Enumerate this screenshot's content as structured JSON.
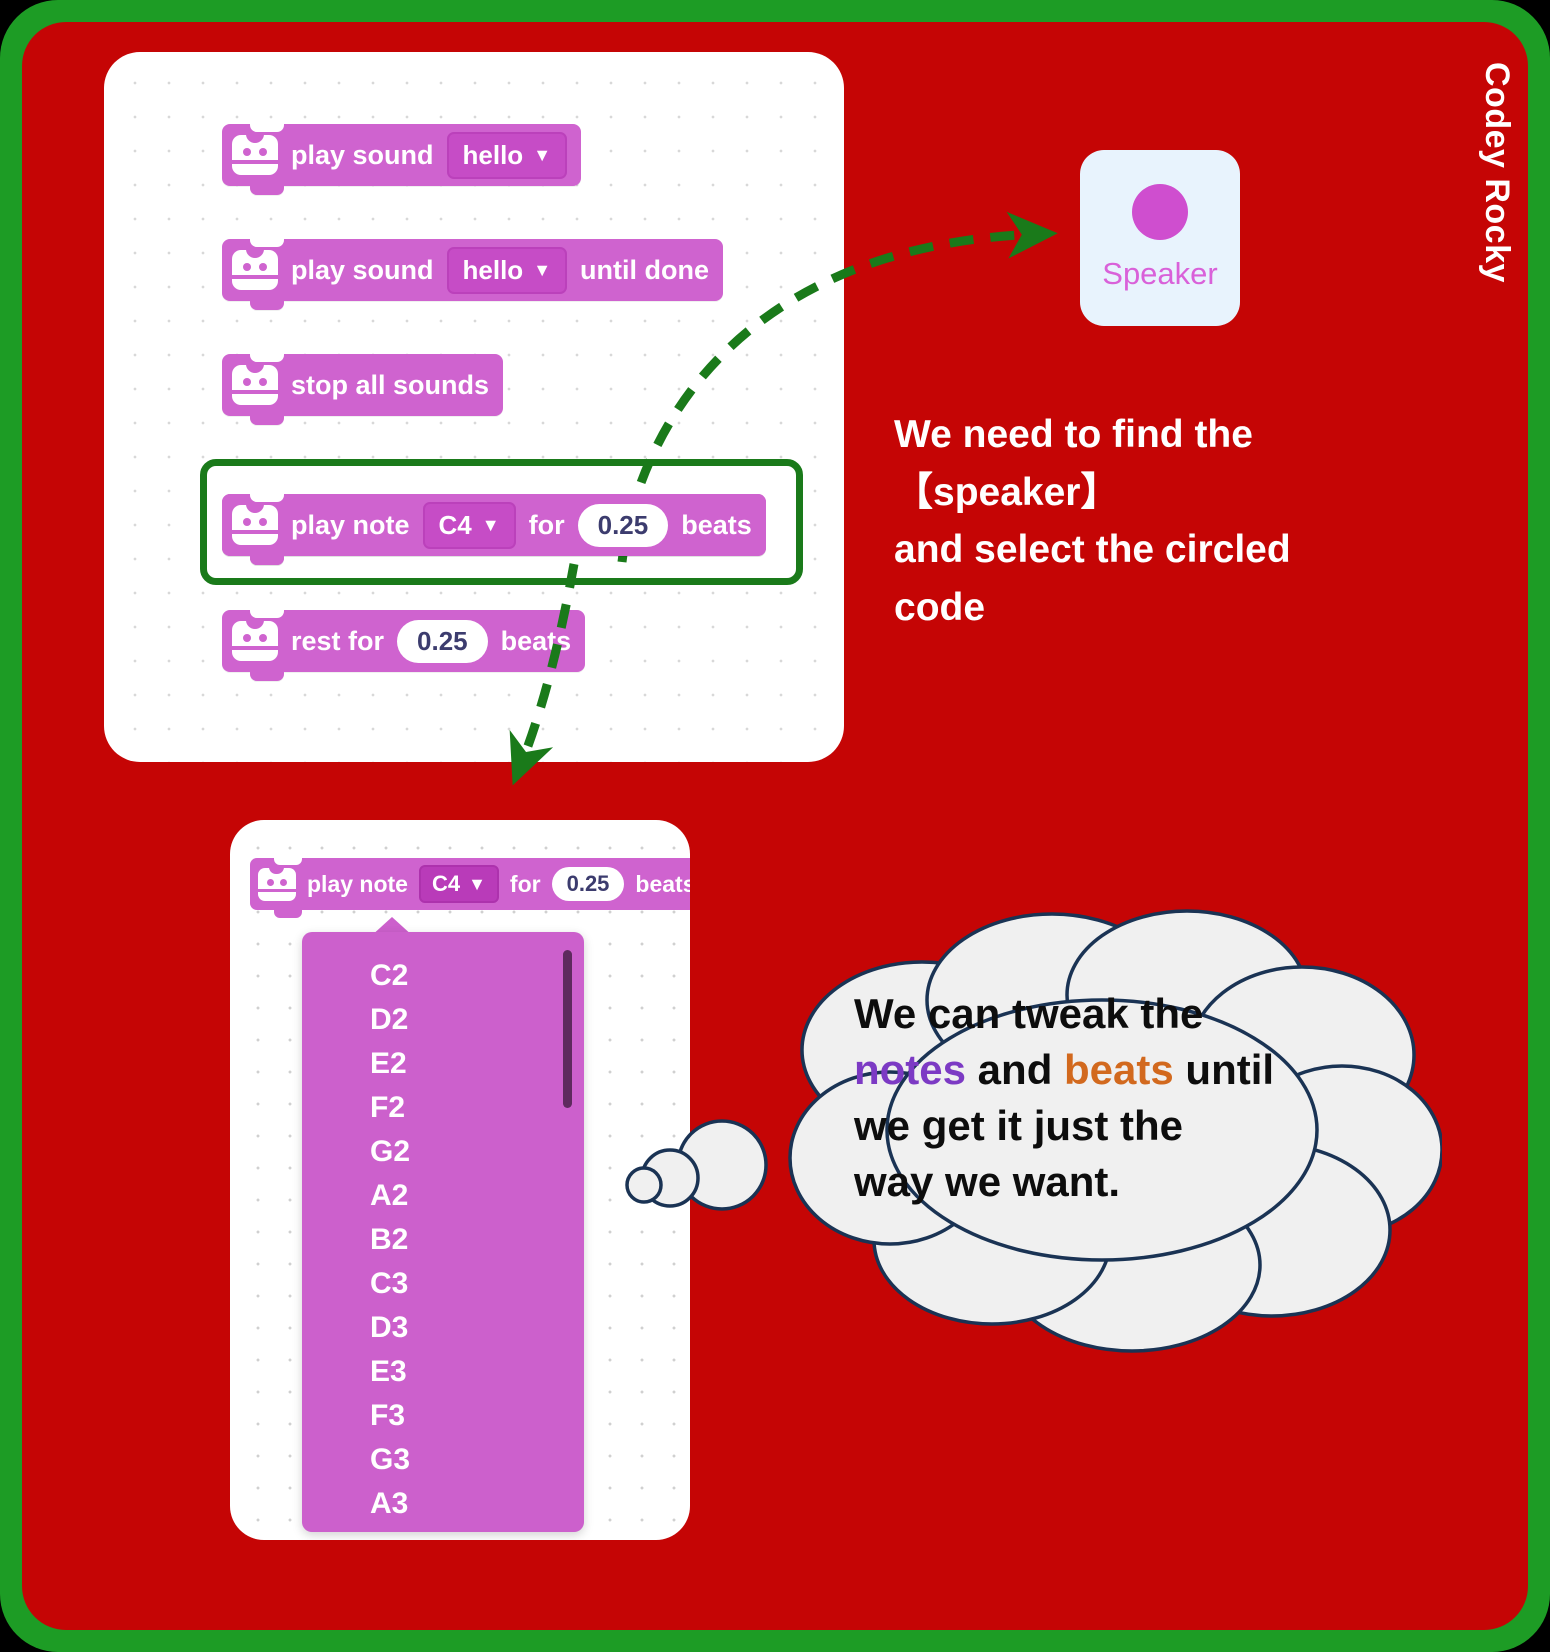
{
  "brand": {
    "label": "Codey Rocky"
  },
  "colors": {
    "frame_green": "#1d9c25",
    "canvas_red": "#c50505",
    "block_magenta": "#cf63cf",
    "arrow_green": "#1a7a1a",
    "speaker_card_bg": "#e8f3fd",
    "speaker_text": "#d961d9",
    "notes_purple": "#7c3ac4",
    "beats_orange": "#d2691e",
    "bubble_outline": "#1a3354",
    "bubble_fill": "#f0f0f0"
  },
  "code_panel": {
    "blocks": [
      {
        "id": "play-sound",
        "text_before": "play sound",
        "dropdown": "hello",
        "text_mid": "",
        "number": "",
        "text_after": ""
      },
      {
        "id": "play-sound-until",
        "text_before": "play sound",
        "dropdown": "hello",
        "text_mid": "",
        "number": "",
        "text_after": "until done"
      },
      {
        "id": "stop-all-sounds",
        "text_before": "stop all sounds",
        "dropdown": "",
        "text_mid": "",
        "number": "",
        "text_after": ""
      },
      {
        "id": "play-note",
        "text_before": "play note",
        "dropdown": "C4",
        "text_mid": "for",
        "number": "0.25",
        "text_after": "beats"
      },
      {
        "id": "rest-for",
        "text_before": "rest for",
        "dropdown": "",
        "text_mid": "",
        "number": "0.25",
        "text_after": "beats"
      }
    ],
    "selected_block_id": "play-note"
  },
  "speaker_card": {
    "label": "Speaker",
    "icon": "speaker-dot-icon"
  },
  "instruction": {
    "text": "We need to find the\n 【speaker】\nand select the circled\ncode"
  },
  "dropdown_panel": {
    "block": {
      "text_before": "play note",
      "dropdown": "C4",
      "text_mid": "for",
      "number": "0.25",
      "text_after": "beats"
    },
    "open_list": {
      "items": [
        "C2",
        "D2",
        "E2",
        "F2",
        "G2",
        "A2",
        "B2",
        "C3",
        "D3",
        "E3",
        "F3",
        "G3",
        "A3"
      ],
      "selected": "C4",
      "scroll_position": "top"
    }
  },
  "thought_bubble": {
    "line1": "We can tweak the",
    "line2_a": "notes",
    "line2_b": " and ",
    "line2_c": "beats",
    "line2_d": " until",
    "line3": "we get it just the",
    "line4": "way we want."
  },
  "annotations": {
    "arrow_to_speaker": "dashed-arrow-to-speaker",
    "arrow_to_dropdown": "dashed-arrow-to-dropdown",
    "selection_outline": "green-selection-rectangle"
  }
}
